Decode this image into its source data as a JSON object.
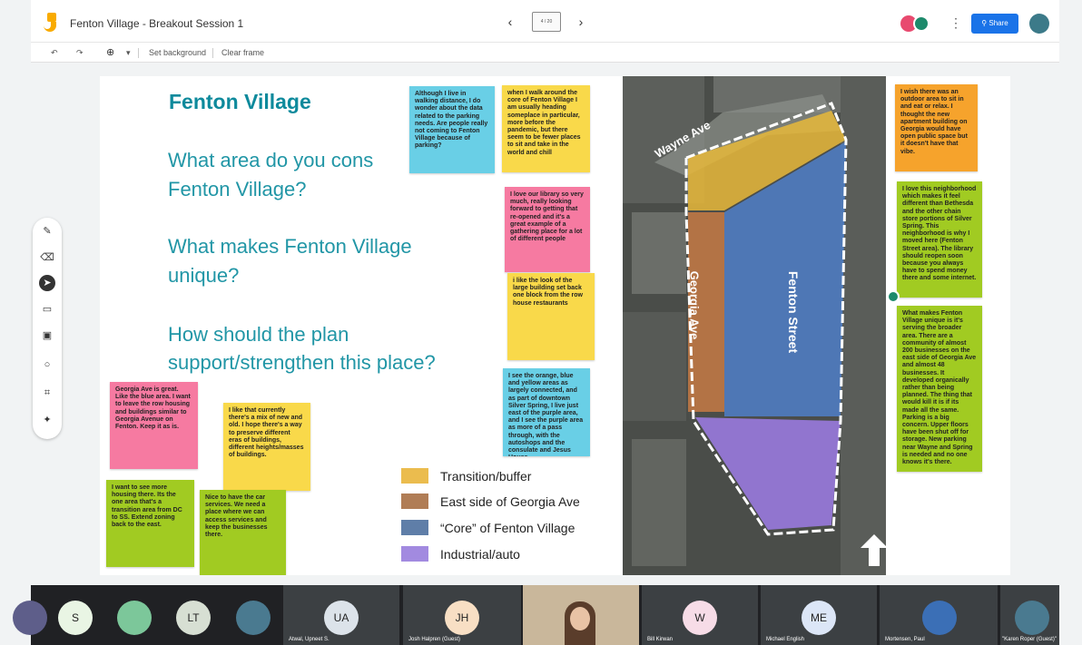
{
  "app": {
    "title": "Fenton Village - Breakout Session 1",
    "frame_counter": "4 / 20",
    "share_label": "Share",
    "more_menu_glyph": "⋮",
    "prev_glyph": "‹",
    "next_glyph": "›"
  },
  "toolbar": {
    "undo_glyph": "↶",
    "redo_glyph": "↷",
    "zoom_glyph": "⊕",
    "zoom_dropdown_glyph": "▾",
    "set_background": "Set background",
    "clear_frame": "Clear frame"
  },
  "side_tools": [
    {
      "name": "pen-tool",
      "glyph": "✎",
      "active": false
    },
    {
      "name": "eraser-tool",
      "glyph": "⌫",
      "active": false
    },
    {
      "name": "select-tool",
      "glyph": "➤",
      "active": true
    },
    {
      "name": "sticky-note-tool",
      "glyph": "▭",
      "active": false
    },
    {
      "name": "image-tool",
      "glyph": "▣",
      "active": false
    },
    {
      "name": "shape-tool",
      "glyph": "○",
      "active": false
    },
    {
      "name": "text-box-tool",
      "glyph": "⌗",
      "active": false
    },
    {
      "name": "laser-tool",
      "glyph": "✦",
      "active": false
    }
  ],
  "slide": {
    "title": "Fenton Village",
    "q1_line1": "What area do you cons",
    "q1_line2": "Fenton Village?",
    "q2_line1": "What makes Fenton Village",
    "q2_line2": "unique?",
    "q3_line1": "How should the plan",
    "q3_line2": "support/strengthen this place?"
  },
  "map": {
    "label_wayne": "Wayne Ave",
    "label_georgia": "Georgia Ave",
    "label_fenton": "Fenton Street"
  },
  "legend": [
    {
      "label": "Transition/buffer",
      "color": "#ebbc4e"
    },
    {
      "label": "East side of Georgia Ave",
      "color": "#b07d56"
    },
    {
      "label": "“Core” of Fenton Village",
      "color": "#5f7ea8"
    },
    {
      "label": "Industrial/auto",
      "color": "#a28ae0"
    }
  ],
  "notes": {
    "parking": "Although I live in walking distance, I do wonder about the data related to the parking needs. Are people really not coming to Fenton Village because of parking?",
    "walk": "when I walk around the core of Fenton Village I am usually heading someplace in particular, more before the pandemic, but there seem to be fewer places to sit and take in the world and chill",
    "library": "I love our library so very much, really looking forward to getting that re-opened and it's a great example of a gathering place for a lot of different people",
    "building": "i like the look of the large building set back one block from the row house restaurants",
    "orange_blue": "I see the orange, blue and yellow areas as largely connected, and as part of downtown Silver Spring, I live just east of the purple area, and I see the purple area as more of a pass through, with the autoshops and the consulate and Jesus House",
    "georgia": "Georgia Ave is great. Like the blue area. I want to leave the row housing and buildings similar to Georgia Avenue on Fenton. Keep it as is.",
    "mix": "I like that currently there's a mix of new and old. I hope there's a way to preserve different eras of buildings, different heights/masses of buildings.",
    "housing": "I want to see more housing there. Its the one area that's a transition area from DC to SS. Extend zoning back to the east.",
    "car": "Nice to have the car services. We need a place where we can access services and keep the businesses there.",
    "outdoor": "I wish there was an outdoor area to sit in and eat or relax. I thought the new apartment building on Georgia would have open public space but it doesn't have that vibe.",
    "neighborhood": "I love this neighborhood which makes it feel different than Bethesda and the other chain store portions of Silver Spring. This neighborhood is why I moved here (Fenton Street area). The library should reopen soon because you always have to spend money there and some internet.",
    "unique": "What makes Fenton Village unique is it's serving the broader area. There are a community of almost 200 businesses on the east side of Georgia Ave and almost 48 businesses. It developed organically rather than being planned. The thing that would kill it is if its made all the same. Parking is a big concern. Upper floors have been shut off for storage. New parking near Wayne and Spring is needed and no one knows it's there."
  },
  "participants": [
    {
      "initials": "S",
      "name": "",
      "color": "#e9f5e4"
    },
    {
      "initials": "",
      "name": "",
      "color": "#7cc79a"
    },
    {
      "initials": "LT",
      "name": "",
      "color": "#d7dfd3"
    },
    {
      "initials": "",
      "name": "",
      "color": "#4a7a90"
    },
    {
      "initials": "UA",
      "name": "Atwal, Upneet S.",
      "color": "#dce3ea"
    },
    {
      "initials": "JH",
      "name": "Josh Halpren (Guest)",
      "color": "#f8dfc4"
    },
    {
      "initials": "",
      "name": "",
      "color": ""
    },
    {
      "initials": "W",
      "name": "Bill Kirwan",
      "color": "#f7dce7"
    },
    {
      "initials": "ME",
      "name": "Michael English",
      "color": "#dce6f7"
    },
    {
      "initials": "",
      "name": "Mortensen, Paul",
      "color": ""
    },
    {
      "initials": "",
      "name": "\"Karen Roper (Guest)\"",
      "color": "#4a7a90"
    }
  ]
}
